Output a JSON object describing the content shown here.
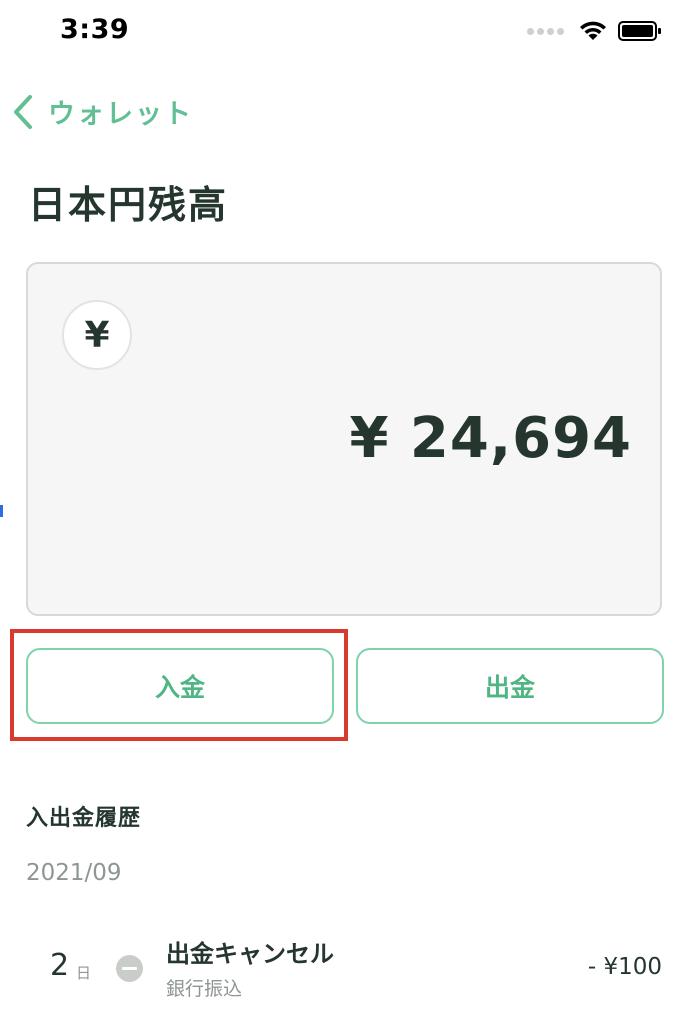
{
  "status_bar": {
    "time": "3:39"
  },
  "nav": {
    "back_label": "ウォレット"
  },
  "page": {
    "title": "日本円残高"
  },
  "balance_card": {
    "currency_symbol": "¥",
    "amount": "¥ 24,694"
  },
  "actions": {
    "deposit_label": "入金",
    "withdraw_label": "出金"
  },
  "history": {
    "section_title": "入出金履歴",
    "month": "2021/09",
    "transactions": [
      {
        "day": "2",
        "day_unit": "日",
        "title": "出金キャンセル",
        "method": "銀行振込",
        "amount": "- ¥100"
      }
    ]
  },
  "colors": {
    "accent": "#62bf94",
    "text_dark": "#24362e",
    "text_muted": "#8d9690",
    "highlight": "#d93a2e"
  }
}
